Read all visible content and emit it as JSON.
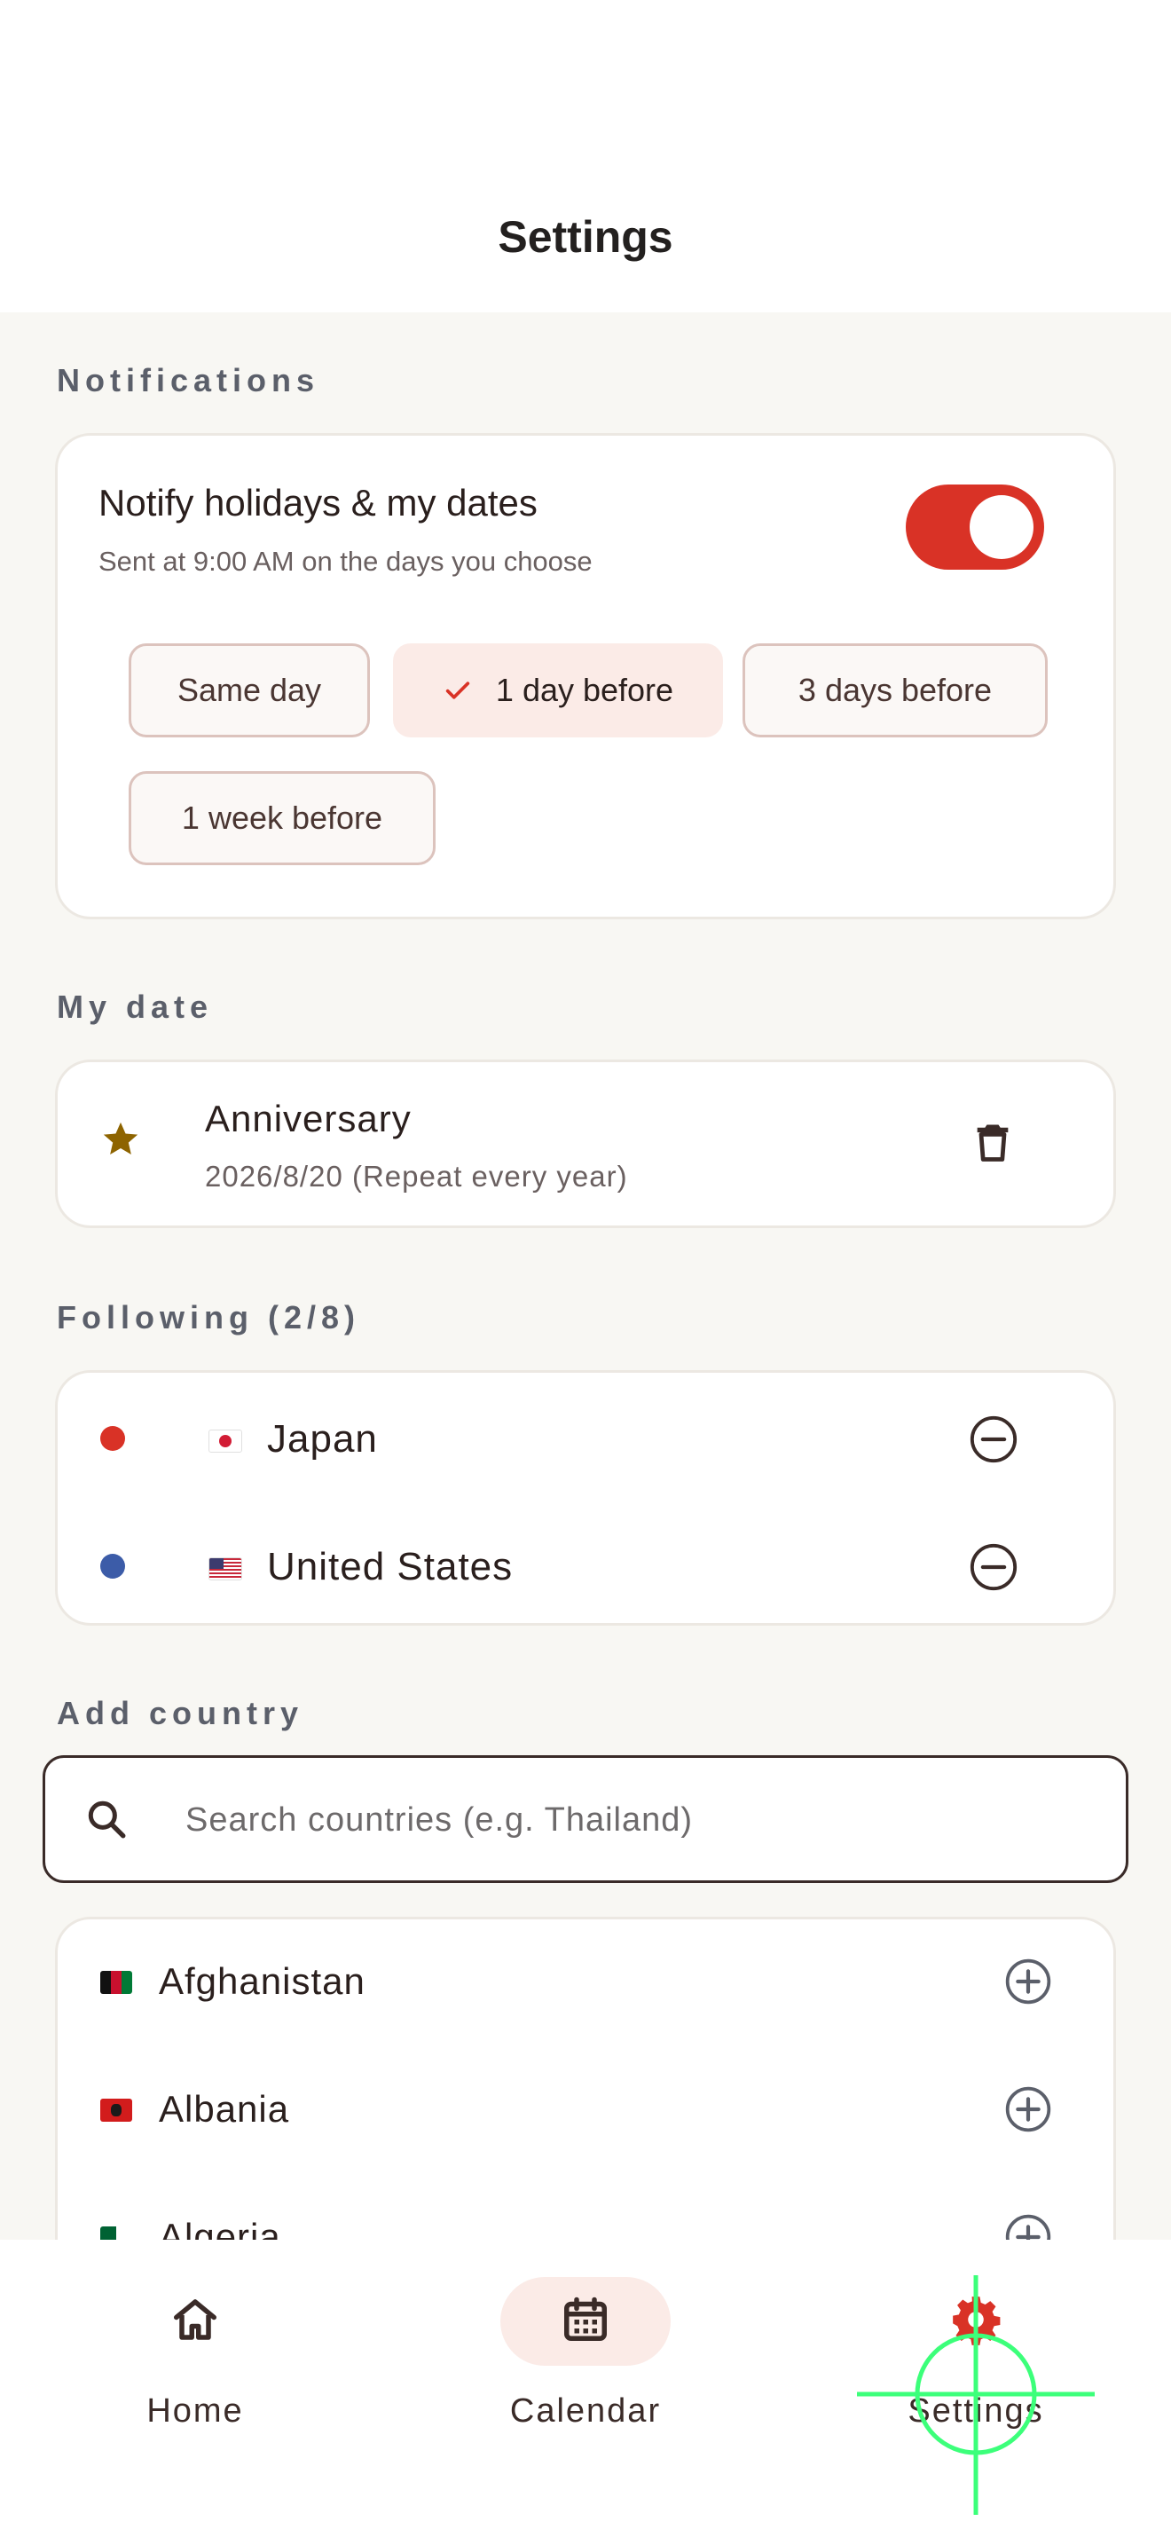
{
  "header": {
    "title": "Settings"
  },
  "notifications": {
    "section_label": "Notifications",
    "title": "Notify holidays & my dates",
    "subtitle": "Sent at 9:00 AM on the days you choose",
    "enabled": true,
    "options": [
      {
        "label": "Same day",
        "selected": false
      },
      {
        "label": "1 day before",
        "selected": true
      },
      {
        "label": "3 days before",
        "selected": false
      },
      {
        "label": "1 week before",
        "selected": false
      }
    ]
  },
  "my_date": {
    "section_label": "My date",
    "item": {
      "title": "Anniversary",
      "subtitle": "2026/8/20 (Repeat every year)",
      "icon": "star-icon",
      "action_icon": "trash-icon"
    }
  },
  "following": {
    "section_label": "Following (2/8)",
    "items": [
      {
        "name": "Japan",
        "dot_color": "#d93226",
        "flag": "jp-flag-icon",
        "action_icon": "minus-circle-icon"
      },
      {
        "name": "United States",
        "dot_color": "#3c5ca8",
        "flag": "us-flag-icon",
        "action_icon": "minus-circle-icon"
      }
    ]
  },
  "add_country": {
    "section_label": "Add country",
    "search": {
      "placeholder": "Search countries (e.g. Thailand)",
      "value": ""
    },
    "results": [
      {
        "name": "Afghanistan",
        "flag": "af-flag-icon",
        "action_icon": "plus-circle-icon"
      },
      {
        "name": "Albania",
        "flag": "al-flag-icon",
        "action_icon": "plus-circle-icon"
      },
      {
        "name": "Algeria",
        "flag": "dz-flag-icon",
        "action_icon": "plus-circle-icon"
      }
    ]
  },
  "bottom_nav": {
    "items": [
      {
        "label": "Home",
        "icon": "home-icon",
        "active": false
      },
      {
        "label": "Calendar",
        "icon": "calendar-icon",
        "active": true
      },
      {
        "label": "Settings",
        "icon": "gear-icon",
        "active": false
      }
    ]
  },
  "colors": {
    "accent": "#d93226",
    "accent_soft": "#fbebe7",
    "background": "#f8f7f3",
    "text": "#2a1f1d",
    "muted": "#5b5f6a"
  }
}
